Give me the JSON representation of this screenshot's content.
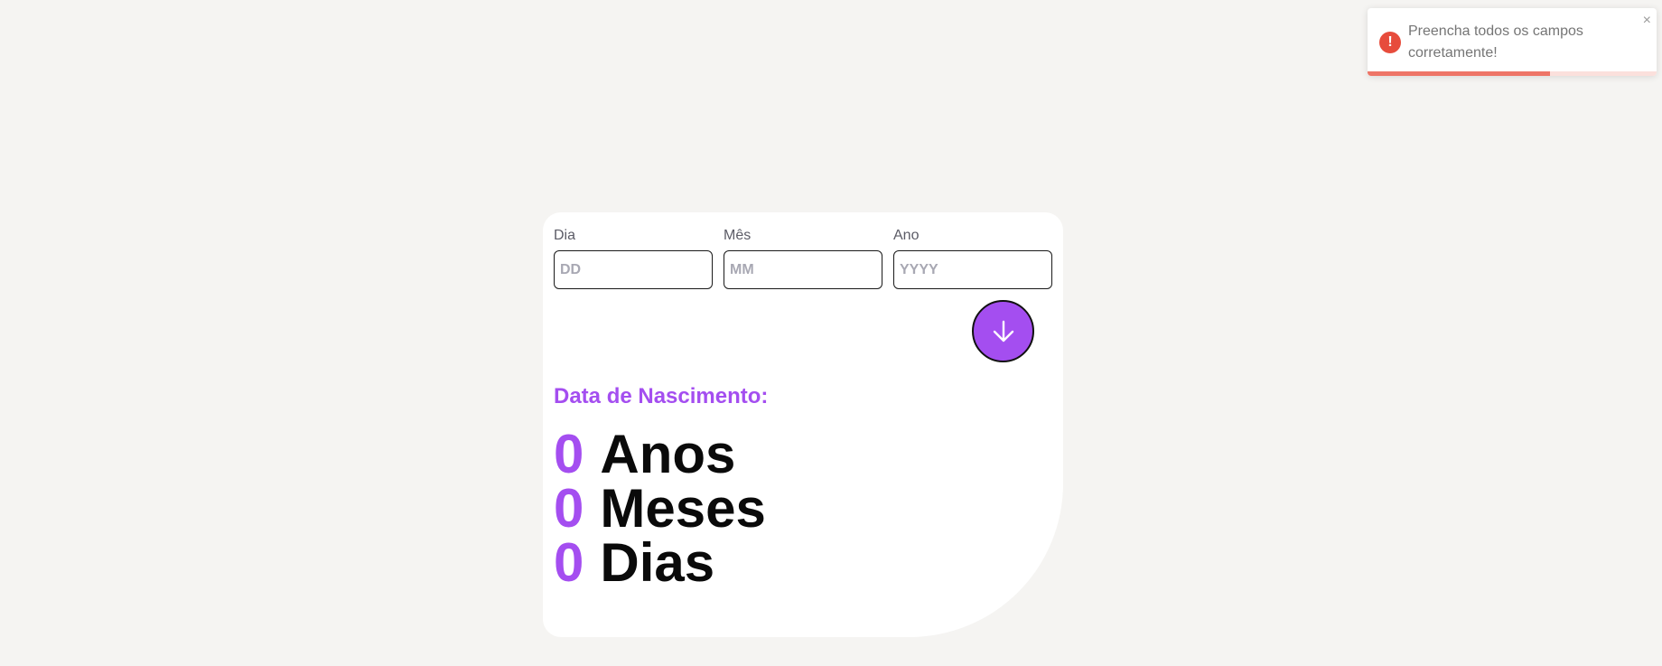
{
  "form": {
    "day": {
      "label": "Dia",
      "placeholder": "DD",
      "value": ""
    },
    "month": {
      "label": "Mês",
      "placeholder": "MM",
      "value": ""
    },
    "year": {
      "label": "Ano",
      "placeholder": "YYYY",
      "value": ""
    },
    "submit_icon": "arrow-down-icon"
  },
  "result": {
    "title": "Data de Nascimento:",
    "rows": [
      {
        "value": "0",
        "unit": "Anos"
      },
      {
        "value": "0",
        "unit": "Meses"
      },
      {
        "value": "0",
        "unit": "Dias"
      }
    ]
  },
  "toast": {
    "type": "error",
    "icon": "error-icon",
    "icon_glyph": "!",
    "message": "Preencha todos os campos corretamente!",
    "close_glyph": "×",
    "progress_fraction": 0.63
  },
  "colors": {
    "accent": "#a44ef0",
    "background": "#f5f4f2",
    "error": "#e74c3c",
    "progress": "#ee7567"
  }
}
